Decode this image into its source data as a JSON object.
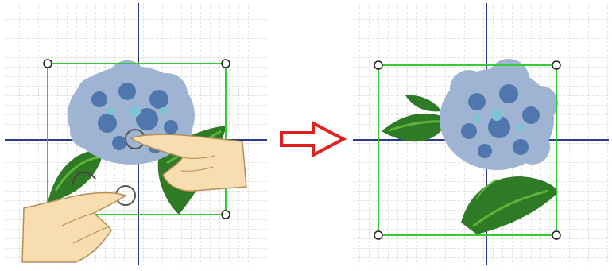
{
  "icons": {
    "before_panel": "embroidery-design-canvas-before",
    "after_panel": "embroidery-design-canvas-after",
    "arrow": "right-arrow-icon",
    "gesture": "two-finger-rotate-gesture",
    "handle": "selection-handle"
  },
  "colors": {
    "grid_line": "#c9c9c9",
    "axis_line": "#2a3a8c",
    "selection_box": "#33cc33",
    "arrow_stroke": "#e02020",
    "petal_light": "#9fb4d2",
    "petal_dark": "#4f76ad",
    "petal_center": "#7dc3d6",
    "leaf_dark": "#2e7a25",
    "leaf_light": "#5cb33a",
    "hand_fill": "#f7ddb0",
    "hand_stroke": "#b58e58"
  }
}
